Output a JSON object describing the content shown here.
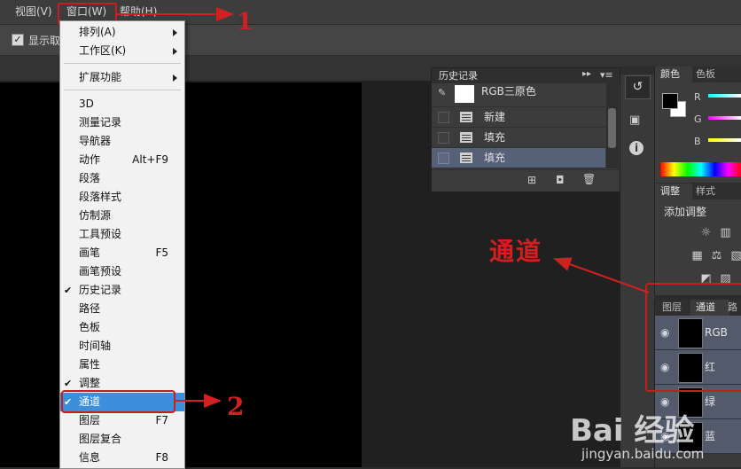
{
  "menubar": {
    "view": "视图(V)",
    "window": "窗口(W)",
    "help": "帮助(H)"
  },
  "options_bar": {
    "show_label": "显示取"
  },
  "window_menu": {
    "items": [
      {
        "label": "排列(A)",
        "submenu": true
      },
      {
        "label": "工作区(K)",
        "submenu": true
      },
      {
        "label": "扩展功能",
        "submenu": true
      },
      {
        "label": "3D"
      },
      {
        "label": "测量记录"
      },
      {
        "label": "导航器"
      },
      {
        "label": "动作",
        "shortcut": "Alt+F9"
      },
      {
        "label": "段落"
      },
      {
        "label": "段落样式"
      },
      {
        "label": "仿制源"
      },
      {
        "label": "工具预设"
      },
      {
        "label": "画笔",
        "shortcut": "F5"
      },
      {
        "label": "画笔预设"
      },
      {
        "label": "历史记录",
        "checked": true
      },
      {
        "label": "路径"
      },
      {
        "label": "色板"
      },
      {
        "label": "时间轴"
      },
      {
        "label": "属性"
      },
      {
        "label": "调整",
        "checked": true
      },
      {
        "label": "通道",
        "checked": true,
        "highlighted": true
      },
      {
        "label": "图层",
        "shortcut": "F7"
      },
      {
        "label": "图层复合"
      },
      {
        "label": "信息",
        "shortcut": "F8"
      }
    ]
  },
  "history_panel": {
    "title": "历史记录",
    "snapshot": "RGB三原色",
    "rows": [
      {
        "label": "新建"
      },
      {
        "label": "填充"
      },
      {
        "label": "填充",
        "selected": true
      }
    ]
  },
  "color_panel": {
    "tabs": [
      "颜色",
      "色板"
    ],
    "channels": [
      "R",
      "G",
      "B"
    ]
  },
  "adjust_panel": {
    "tabs": [
      "调整",
      "样式"
    ],
    "add_label": "添加调整"
  },
  "channels_panel": {
    "tabs": [
      "图层",
      "通道",
      "路径"
    ],
    "rows": [
      {
        "name": "RGB"
      },
      {
        "name": "红"
      },
      {
        "name": "绿"
      },
      {
        "name": "蓝"
      }
    ]
  },
  "annotations": {
    "step1": "1",
    "step2": "2",
    "channel_label": "通道"
  },
  "watermark": {
    "brand": "Bai 经验",
    "url": "jingyan.baidu.com"
  },
  "colors": {
    "highlight": "#3b8fdb",
    "annotation": "#d21f1f",
    "channel_row": "#535a6b"
  }
}
